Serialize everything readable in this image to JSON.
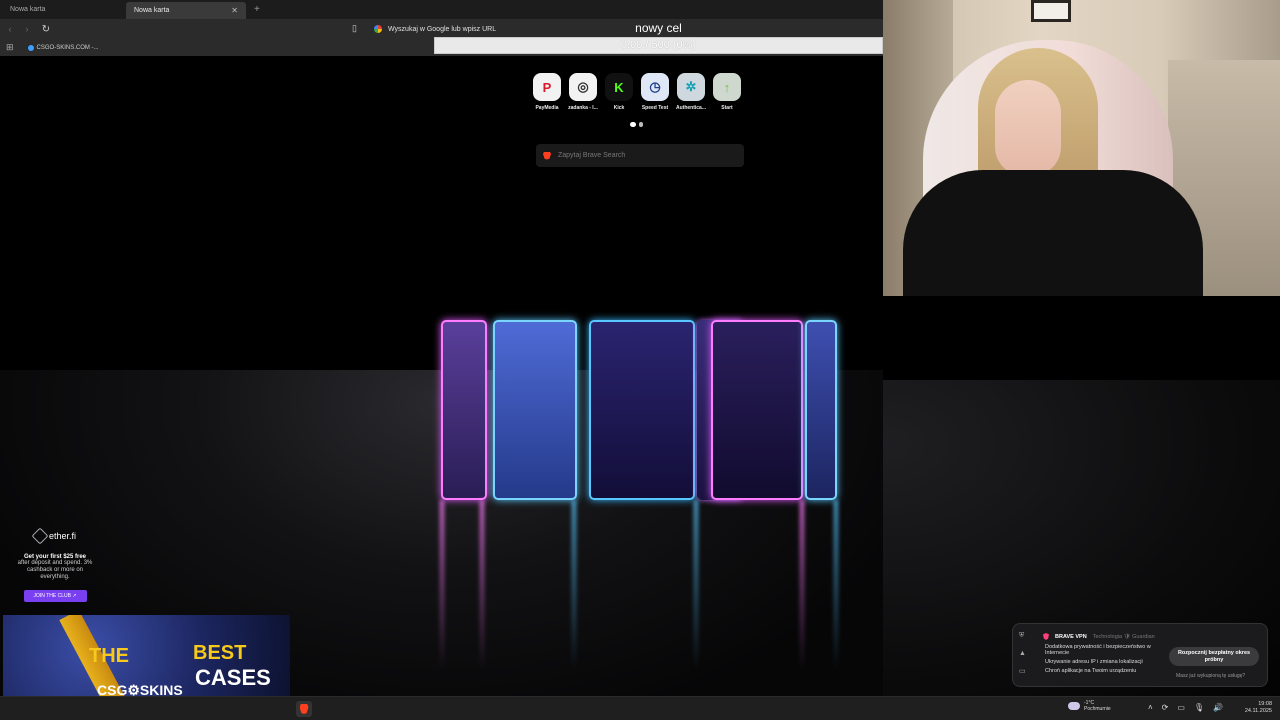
{
  "browser": {
    "tabs": [
      {
        "label": "Nowa karta",
        "active": false
      },
      {
        "label": "Nowa karta",
        "active": true
      }
    ],
    "url_placeholder": "Wyszukaj w Google lub wpisz URL",
    "bookmarks": [
      {
        "label": "CSGO-SKINS.COM -..."
      }
    ]
  },
  "goal": {
    "title": "nowy cel",
    "progress_text": "0.00 / 500 (0%)",
    "progress_fraction": 0,
    "fill_color": "#f06a9c"
  },
  "newtab": {
    "speed_dials": [
      {
        "label": "PayMedia",
        "icon": "paymedia-icon",
        "bg": "#f2f2f2",
        "fg": "#d81a2a",
        "glyph": "P"
      },
      {
        "label": "zadanka - I...",
        "icon": "zadanka-icon",
        "bg": "#f2f2f2",
        "fg": "#333",
        "glyph": "◎"
      },
      {
        "label": "Kick",
        "icon": "kick-icon",
        "bg": "#111",
        "fg": "#53fc18",
        "glyph": "K"
      },
      {
        "label": "Speed Test",
        "icon": "speedtest-icon",
        "bg": "#dfe6f5",
        "fg": "#1d3f8a",
        "glyph": "◷"
      },
      {
        "label": "Authentica...",
        "icon": "authenticator-icon",
        "bg": "#cfd8df",
        "fg": "#17a2b8",
        "glyph": "✲"
      },
      {
        "label": "Start",
        "icon": "start-icon",
        "bg": "#cfd8cf",
        "fg": "#7bc043",
        "glyph": "↑"
      }
    ],
    "search_placeholder": "Zapytaj Brave Search"
  },
  "ad": {
    "brand": "ether.fi",
    "headline": "Get your first $25 free",
    "text": "after deposit and spend. 3% cashback or more on everything.",
    "button": "JOIN THE CLUB ↗"
  },
  "banner": {
    "line1": "THE",
    "line2": "BEST",
    "line3": "CASES",
    "brand": "CSG⚙SKINS"
  },
  "vpn": {
    "title": "BRAVE VPN",
    "subtitle": "Technologia 🛡 Guardian",
    "features": [
      "Dodatkowa prywatność i bezpieczeństwo w Internecie",
      "Ukrywanie adresu IP i zmiana lokalizacji",
      "Chroń aplikacje na Twoim urządzeniu"
    ],
    "cta": "Rozpocznij bezpłatny okres próbny",
    "note": "Masz już wykupioną tę usługę?"
  },
  "taskbar": {
    "weather_temp": "-1°C",
    "weather_desc": "Pochmurnie",
    "time": "19:08",
    "date": "24.11.2025"
  },
  "colors": {
    "accent": "#ff3f1f",
    "ad_button": "#7b3ff2"
  }
}
